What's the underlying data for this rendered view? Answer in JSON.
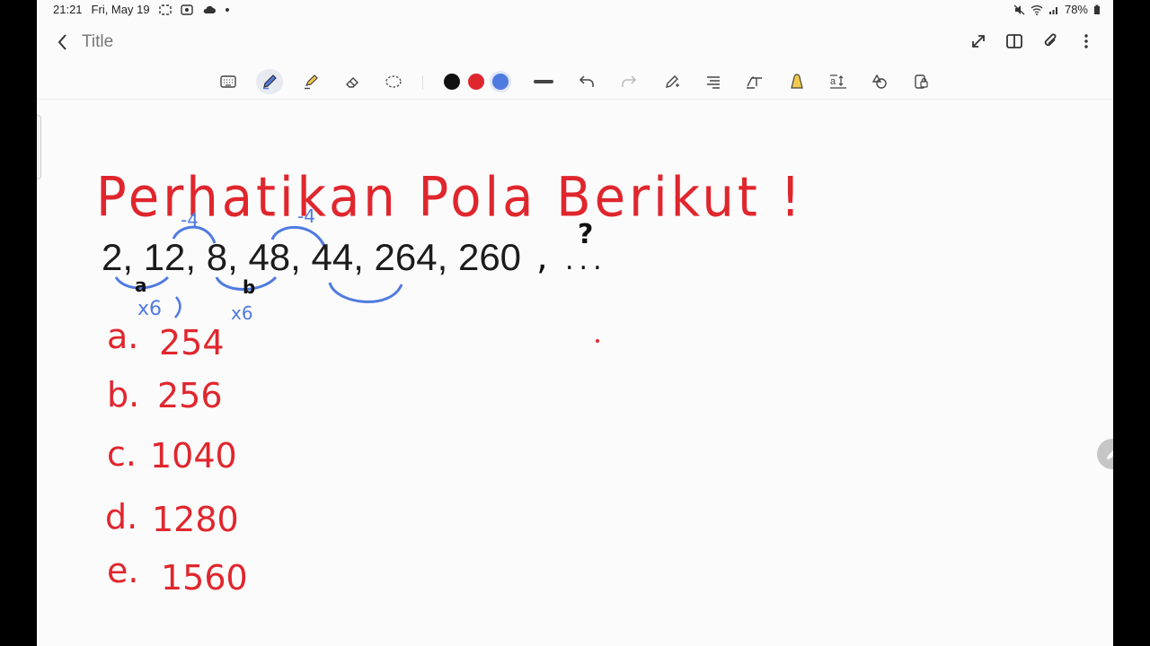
{
  "status": {
    "time": "21:21",
    "date": "Fri, May 19",
    "battery": "78%"
  },
  "appbar": {
    "title": "Title",
    "icons": [
      "back-chevron-icon",
      "expand-icon",
      "book-icon",
      "paperclip-icon",
      "more-vert-icon"
    ]
  },
  "toolbar": {
    "tools": [
      "keyboard-icon",
      "pen-icon",
      "highlighter-icon",
      "eraser-icon",
      "lasso-icon"
    ],
    "colors": [
      "#111111",
      "#e0262d",
      "#4f7ae0"
    ],
    "actions": [
      "stroke-width-icon",
      "undo-icon",
      "redo-icon",
      "pen-settings-icon",
      "straighten-icon",
      "handwriting-text-icon",
      "shape-fill-icon",
      "text-icon",
      "shapes-icon",
      "lock-icon"
    ]
  },
  "canvas": {
    "heading": "Perhatikan Pola Berikut !",
    "sequence": "2, 12, 8, 48, 44, 264, 260",
    "sequence_comma": ",",
    "ellipsis": "...",
    "question_mark": "?",
    "annotations": {
      "minus_1": "-4",
      "minus_2": "-4",
      "times_1": "x6",
      "times_2": "x6",
      "label_a": "a",
      "label_b": "b"
    },
    "options": [
      {
        "letter": "a.",
        "value": "254"
      },
      {
        "letter": "b.",
        "value": "256"
      },
      {
        "letter": "c.",
        "value": "1040"
      },
      {
        "letter": "d.",
        "value": "1280"
      },
      {
        "letter": "e.",
        "value": "1560"
      }
    ]
  }
}
